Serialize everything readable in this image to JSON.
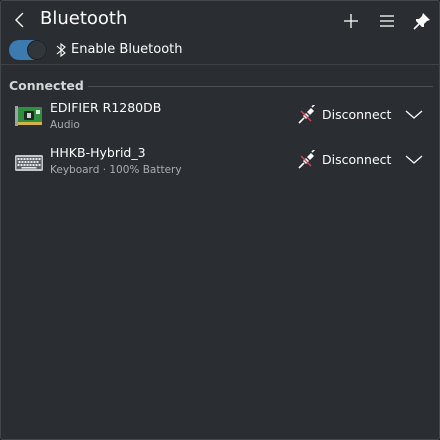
{
  "header": {
    "title": "Bluetooth",
    "back_icon": "chevron-left-icon",
    "add_icon": "plus-icon",
    "menu_icon": "hamburger-menu-icon",
    "pin_icon": "pin-icon"
  },
  "enable": {
    "label": "Enable Bluetooth",
    "checked": true,
    "icon": "bluetooth-icon"
  },
  "section": {
    "title": "Connected"
  },
  "devices": [
    {
      "name": "EDIFIER R1280DB",
      "subtitle": "Audio",
      "icon": "audio-card-icon",
      "action_label": "Disconnect",
      "action_icon": "disconnect-plug-icon",
      "expand_icon": "chevron-down-icon"
    },
    {
      "name": "HHKB-Hybrid_3",
      "subtitle": "Keyboard · 100% Battery",
      "icon": "keyboard-icon",
      "action_label": "Disconnect",
      "action_icon": "disconnect-plug-icon",
      "expand_icon": "chevron-down-icon"
    }
  ],
  "colors": {
    "background": "#2a2e32",
    "accent": "#3d7aaf",
    "text": "#fcfcfc",
    "subtext": "#a9adb1"
  }
}
